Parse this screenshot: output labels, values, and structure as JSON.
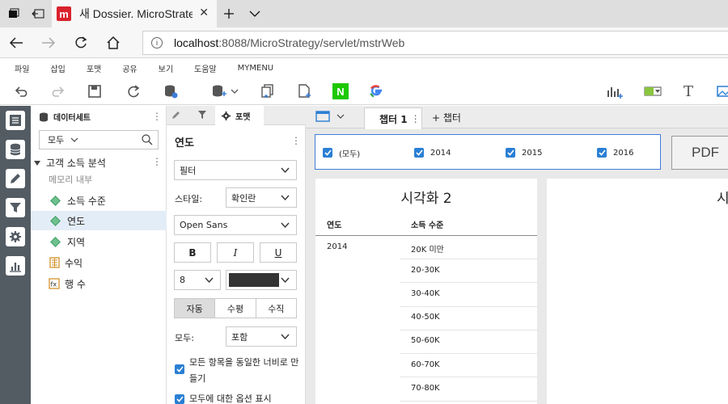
{
  "browser": {
    "tab_title": "새 Dossier. MicroStrategy",
    "url_host": "localhost",
    "url_path": ":8088/MicroStrategy/servlet/mstrWeb"
  },
  "menu": [
    "파일",
    "삽입",
    "포맷",
    "공유",
    "보기",
    "도움말",
    "MYMENU"
  ],
  "dataset_panel": {
    "title": "데이터세트",
    "scope_select": "모두",
    "dataset_name": "고객 소득 분석",
    "dataset_sub": "메모리 내부",
    "items": [
      {
        "label": "소득 수준",
        "kind": "attribute"
      },
      {
        "label": "연도",
        "kind": "attribute",
        "selected": true
      },
      {
        "label": "지역",
        "kind": "attribute"
      },
      {
        "label": "수익",
        "kind": "metric"
      },
      {
        "label": "행 수",
        "kind": "derived"
      }
    ]
  },
  "format_panel": {
    "tab_label": "포맷",
    "section_title": "연도",
    "target_select": "필터",
    "style_label": "스타일:",
    "style_value": "확인란",
    "font_value": "Open Sans",
    "bold": "B",
    "italic": "I",
    "underline": "U",
    "font_size": "8",
    "color_swatch": "#333333",
    "orient_buttons": [
      "자동",
      "수평",
      "수직"
    ],
    "all_label": "모두:",
    "all_value": "포함",
    "check1": "모든 항목을 동일한 너비로 만들기",
    "check2": "모두에 대한 옵션 표시"
  },
  "canvas": {
    "chapter_tab": "챕터 1",
    "add_chapter": "+ 챕터",
    "filter_items": [
      "(모두)",
      "2014",
      "2015",
      "2016"
    ],
    "pdf_label": "PDF",
    "viz_title": "시각화 2",
    "viz2_title_fragment": "시",
    "grid_headers": [
      "연도",
      "소득 수준"
    ],
    "grid_year": "2014",
    "grid_rows": [
      "20K 미만",
      "20-30K",
      "30-40K",
      "40-50K",
      "50-60K",
      "60-70K",
      "70-80K"
    ]
  },
  "colors": {
    "accent": "#3e7ed8",
    "rail": "#535b63",
    "attribute_diamond": "#6fc18f",
    "mstr_red": "#d9232e"
  }
}
